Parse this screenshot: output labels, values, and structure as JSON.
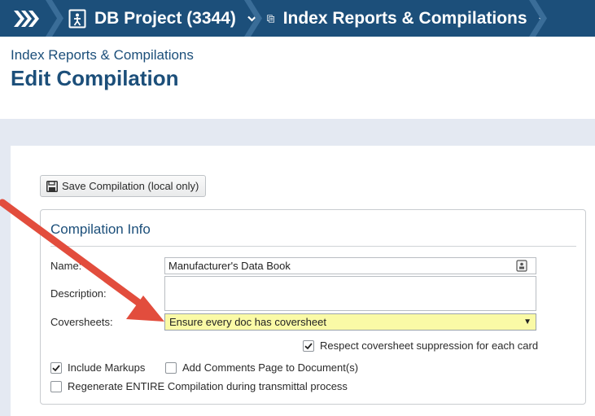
{
  "breadcrumbs": {
    "project": "DB Project (3344)",
    "section": "Index Reports & Compilations"
  },
  "header": {
    "subtitle": "Index Reports & Compilations",
    "title": "Edit Compilation"
  },
  "toolbar": {
    "save_label": "Save Compilation (local only)"
  },
  "compilation_info": {
    "legend": "Compilation Info",
    "name_label": "Name:",
    "name_value": "Manufacturer's Data Book",
    "description_label": "Description:",
    "description_value": "",
    "coversheets_label": "Coversheets:",
    "coversheets_selected": "Ensure every doc has coversheet",
    "respect_suppression_label": "Respect coversheet suppression for each card",
    "respect_suppression_checked": true,
    "include_markups_label": "Include Markups",
    "include_markups_checked": true,
    "add_comments_label": "Add Comments Page to Document(s)",
    "add_comments_checked": false,
    "regenerate_label": "Regenerate ENTIRE Compilation during transmittal process",
    "regenerate_checked": false
  },
  "colors": {
    "topbar": "#1c4f7a",
    "accent_text": "#1c4f7a",
    "select_highlight": "#fafaa6",
    "annotation_arrow": "#e24d3d"
  },
  "icons": {
    "home": "triple-chevron-icon",
    "project": "project-icon",
    "section": "documents-icon",
    "save": "floppy-disk-icon",
    "id_card": "id-card-icon"
  }
}
